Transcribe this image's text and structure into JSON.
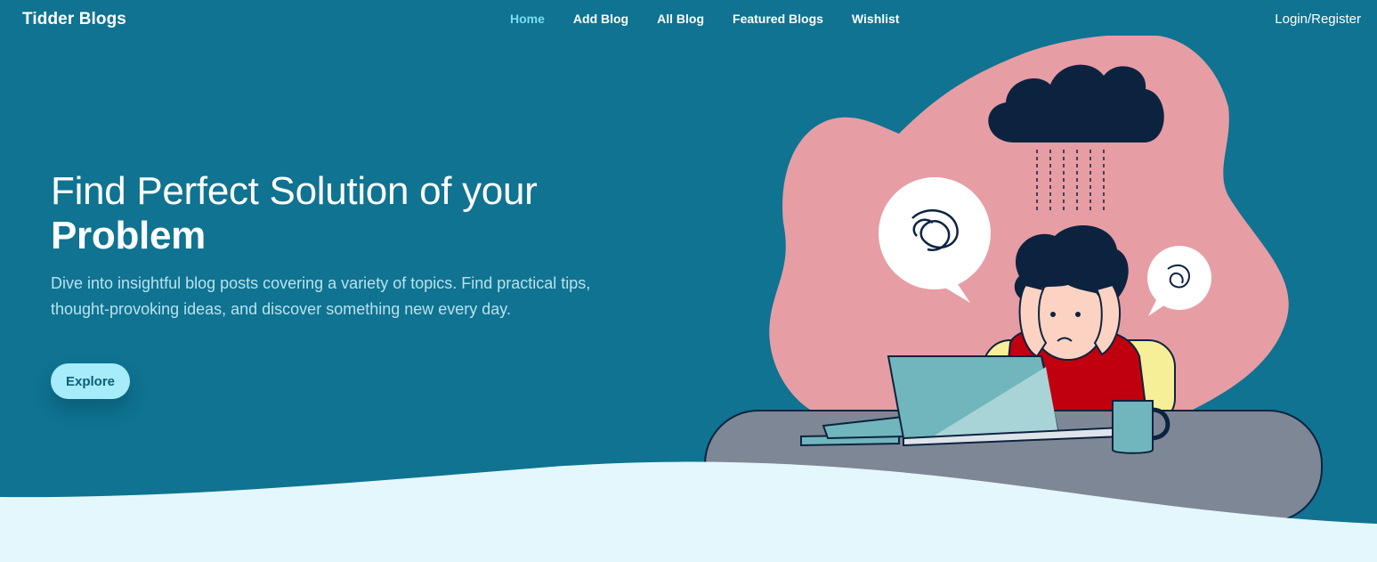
{
  "nav": {
    "brand": "Tidder Blogs",
    "links": [
      {
        "label": "Home",
        "active": true
      },
      {
        "label": "Add Blog",
        "active": false
      },
      {
        "label": "All Blog",
        "active": false
      },
      {
        "label": "Featured Blogs",
        "active": false
      },
      {
        "label": "Wishlist",
        "active": false
      }
    ],
    "login": "Login/Register"
  },
  "hero": {
    "headline_line1": "Find Perfect Solution of your",
    "headline_line2": "Problem",
    "lead": "Dive into insightful blog posts covering a variety of topics. Find practical tips, thought-provoking ideas, and discover something new every day.",
    "cta": "Explore"
  },
  "colors": {
    "background": "#0f7391",
    "accent": "#7fdcf6",
    "cta_bg": "#a6ecfb",
    "blob": "#e79da4",
    "wave": "#e3f7fd"
  },
  "illustration": {
    "icons": [
      "rain-cloud-icon",
      "scribble-thought-icon",
      "laptop-icon",
      "mug-icon"
    ]
  }
}
